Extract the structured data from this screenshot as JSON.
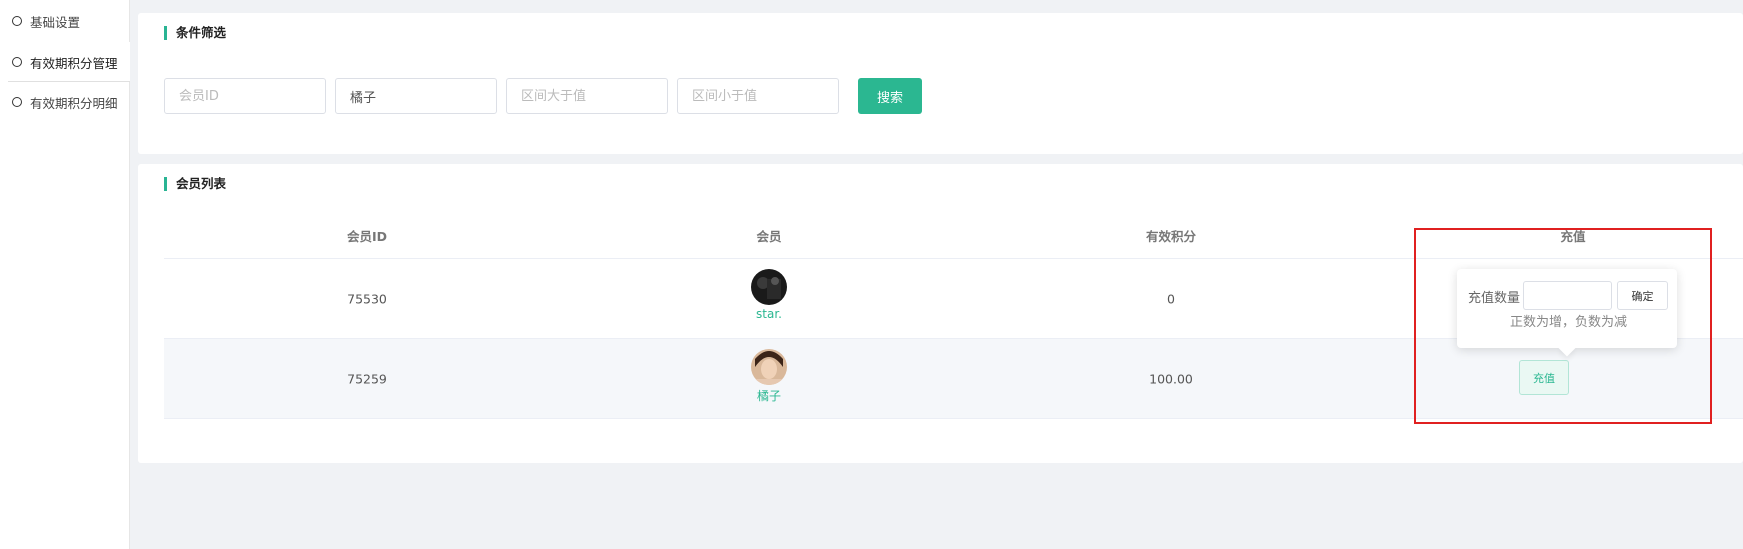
{
  "sidebar": {
    "items": [
      {
        "label": "基础设置"
      },
      {
        "label": "有效期积分管理"
      },
      {
        "label": "有效期积分明细"
      }
    ]
  },
  "filter": {
    "title": "条件筛选",
    "member_id_placeholder": "会员ID",
    "member_value": "橘子",
    "range_min_placeholder": "区间大于值",
    "range_max_placeholder": "区间小于值",
    "search_label": "搜索"
  },
  "list": {
    "title": "会员列表",
    "columns": [
      "会员ID",
      "会员",
      "有效积分",
      "充值"
    ],
    "rows": [
      {
        "id": "75530",
        "name": "star.",
        "points": "0"
      },
      {
        "id": "75259",
        "name": "橘子",
        "points": "100.00",
        "action": "充值"
      }
    ]
  },
  "popover": {
    "label": "充值数量",
    "input_value": "",
    "confirm_label": "确定",
    "hint": "正数为增，负数为减"
  },
  "colors": {
    "accent": "#2bb791",
    "highlight": "#e02020"
  }
}
